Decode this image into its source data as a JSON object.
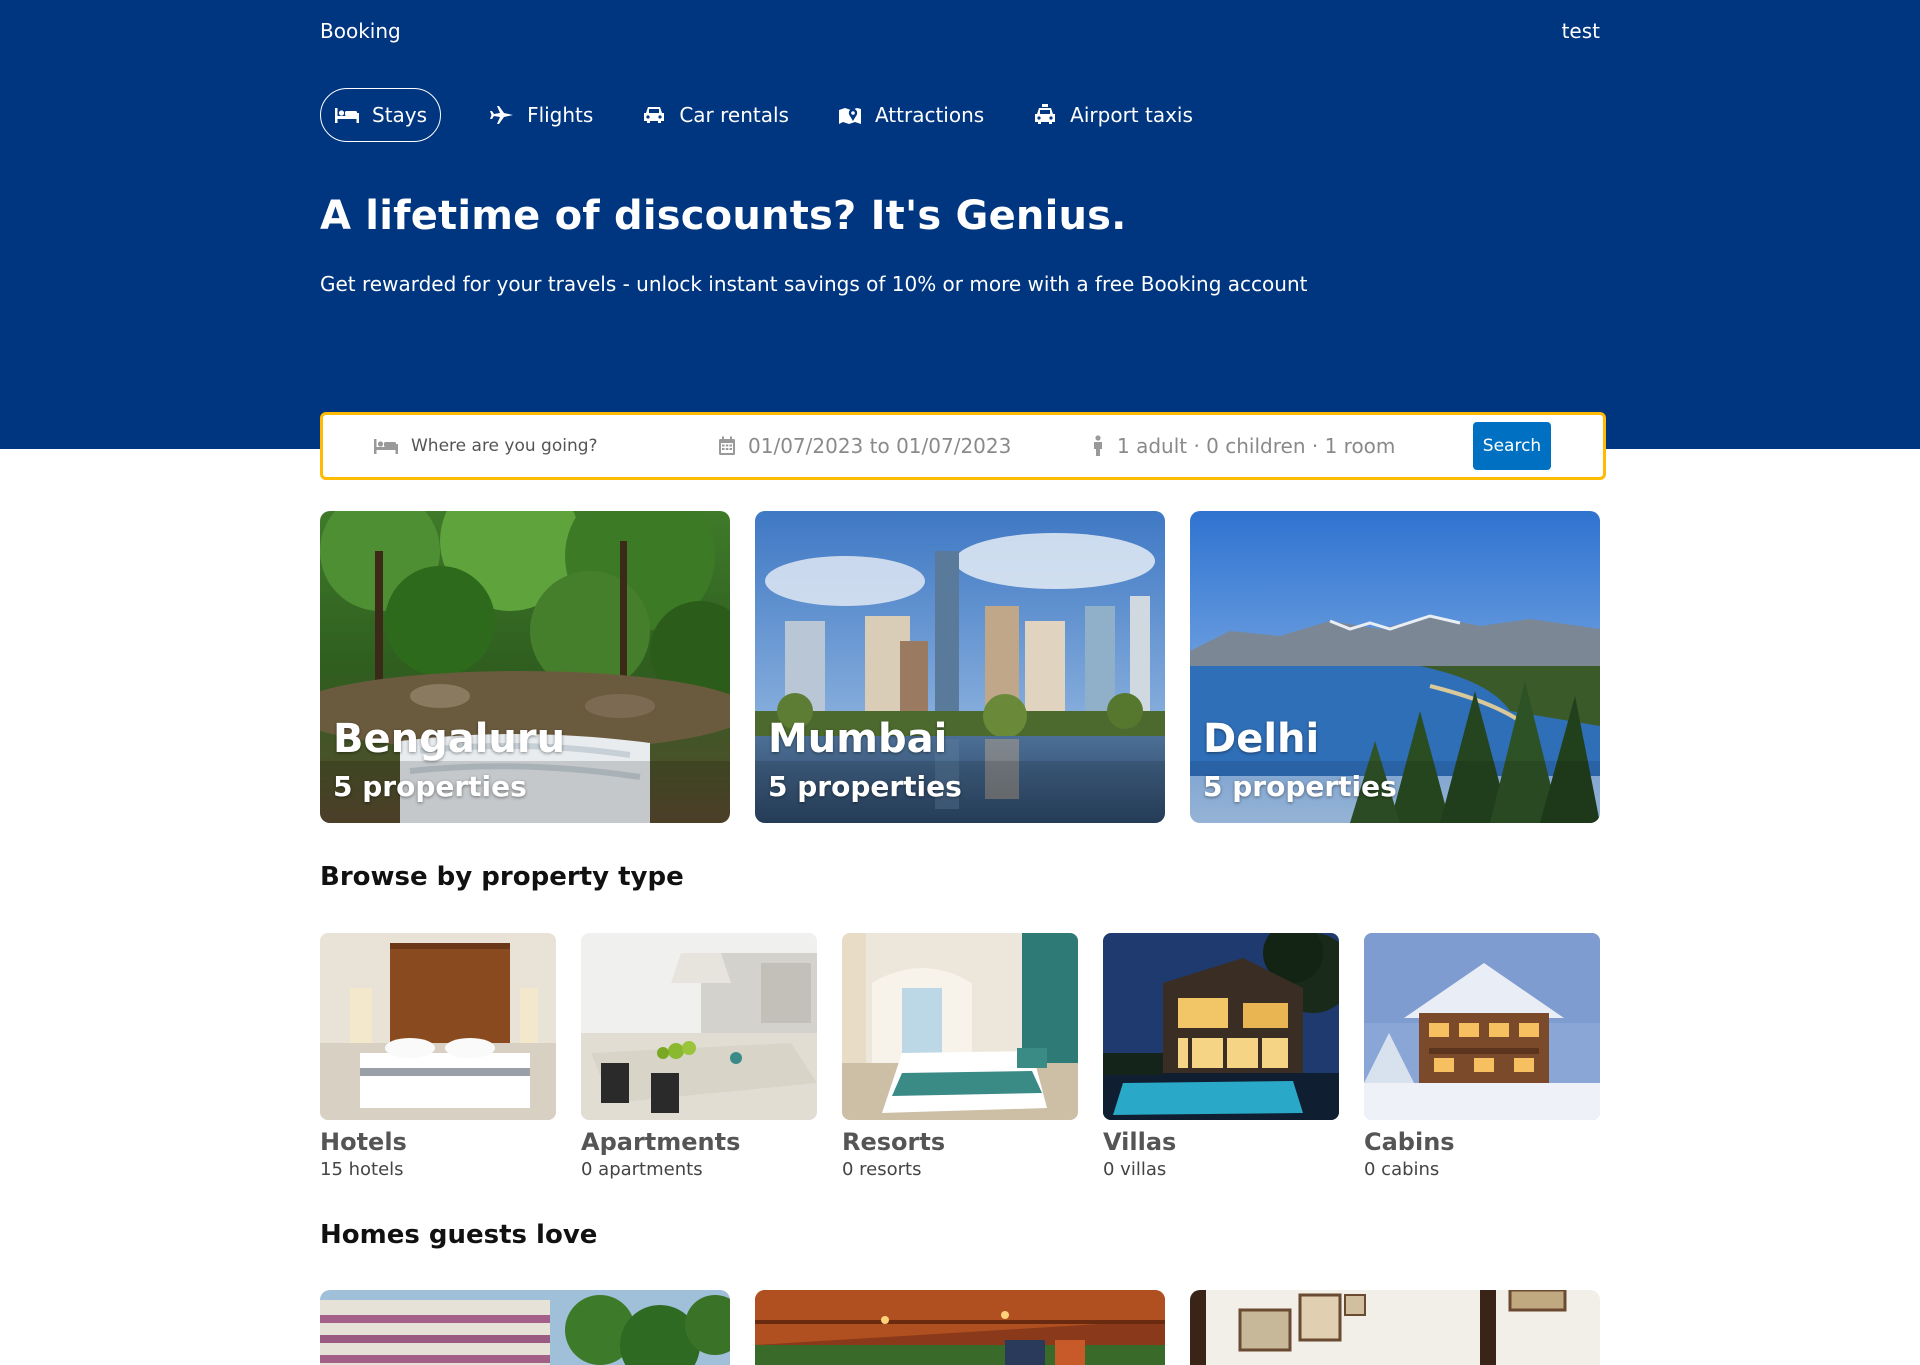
{
  "header": {
    "brand": "Booking",
    "user": "test",
    "nav": [
      {
        "label": "Stays",
        "icon": "bed-icon",
        "active": true
      },
      {
        "label": "Flights",
        "icon": "plane-icon",
        "active": false
      },
      {
        "label": "Car rentals",
        "icon": "car-icon",
        "active": false
      },
      {
        "label": "Attractions",
        "icon": "map-pin-icon",
        "active": false
      },
      {
        "label": "Airport taxis",
        "icon": "taxi-icon",
        "active": false
      }
    ],
    "headline": "A lifetime of discounts? It's Genius.",
    "subline": "Get rewarded for your travels - unlock instant savings of 10% or more with a free Booking account"
  },
  "search": {
    "destination_placeholder": "Where are you going?",
    "destination_value": "",
    "dates": "01/07/2023 to 01/07/2023",
    "guests": "1 adult · 0 children · 1 room",
    "button": "Search"
  },
  "cities": [
    {
      "name": "Bengaluru",
      "count": "5 properties",
      "scene": "forest-stream"
    },
    {
      "name": "Mumbai",
      "count": "5 properties",
      "scene": "city-skyline"
    },
    {
      "name": "Delhi",
      "count": "5 properties",
      "scene": "lake-mountains"
    }
  ],
  "property_types": {
    "title": "Browse by property type",
    "items": [
      {
        "name": "Hotels",
        "count": "15 hotels"
      },
      {
        "name": "Apartments",
        "count": "0 apartments"
      },
      {
        "name": "Resorts",
        "count": "0 resorts"
      },
      {
        "name": "Villas",
        "count": "0 villas"
      },
      {
        "name": "Cabins",
        "count": "0 cabins"
      }
    ]
  },
  "homes": {
    "title": "Homes guests love"
  },
  "colors": {
    "header_bg": "#003580",
    "search_border": "#febb02",
    "search_button": "#0071c2"
  }
}
